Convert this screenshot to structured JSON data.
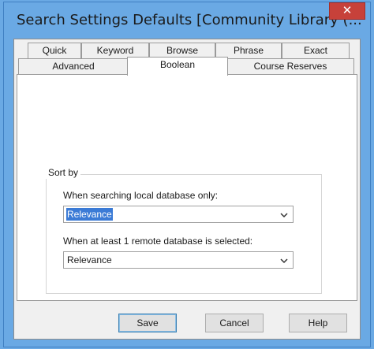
{
  "window": {
    "title": "Search Settings Defaults [Community Library (...",
    "close_glyph": "✕"
  },
  "tabs": {
    "row1": [
      "Quick",
      "Keyword",
      "Browse",
      "Phrase",
      "Exact"
    ],
    "row2": [
      "Advanced",
      "Boolean",
      "Course Reserves"
    ],
    "selected": "Boolean"
  },
  "sort_by": {
    "group_label": "Sort by",
    "local_label": "When searching local database only:",
    "local_value": "Relevance",
    "remote_label": "When at least 1 remote database is selected:",
    "remote_value": "Relevance"
  },
  "buttons": {
    "save": "Save",
    "cancel": "Cancel",
    "help": "Help"
  },
  "colors": {
    "title_bar": "#6aa9e4",
    "close_button": "#c7413a",
    "selection_highlight": "#3b7bd6"
  },
  "icons": {
    "close": "close-icon",
    "dropdown": "chevron-down-icon"
  }
}
